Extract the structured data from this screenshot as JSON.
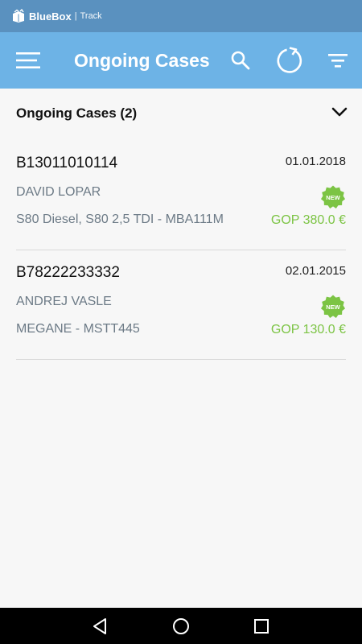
{
  "status_bar": {
    "brand_name": "BlueBox",
    "brand_separator": "|",
    "brand_sub": "Track",
    "logo_icon": "box-logo-icon"
  },
  "app_bar": {
    "title": "Ongoing Cases",
    "menu_icon": "hamburger-menu-icon",
    "search_icon": "search-icon",
    "refresh_icon": "refresh-icon",
    "filter_icon": "filter-icon",
    "background_color": "#6db3e6"
  },
  "section": {
    "title": "Ongoing Cases (2)",
    "expand_icon": "chevron-down-icon"
  },
  "cases": [
    {
      "id": "B13011010114",
      "date": "01.01.2018",
      "name": "DAVID LOPAR",
      "vehicle": "S80 Diesel, S80 2,5 TDI - MBA111M",
      "price": "GOP 380.0 €",
      "badge": "NEW"
    },
    {
      "id": "B78222233332",
      "date": "02.01.2015",
      "name": "ANDREJ VASLE",
      "vehicle": "MEGANE - MSTT445",
      "price": "GOP 130.0 €",
      "badge": "NEW"
    }
  ],
  "colors": {
    "status_bar": "#5a91bf",
    "accent_green": "#7cc444",
    "muted_text": "#6c7a86"
  },
  "nav_bar": {
    "back_icon": "back-triangle-icon",
    "home_icon": "home-circle-icon",
    "recent_icon": "recent-apps-square-icon"
  }
}
